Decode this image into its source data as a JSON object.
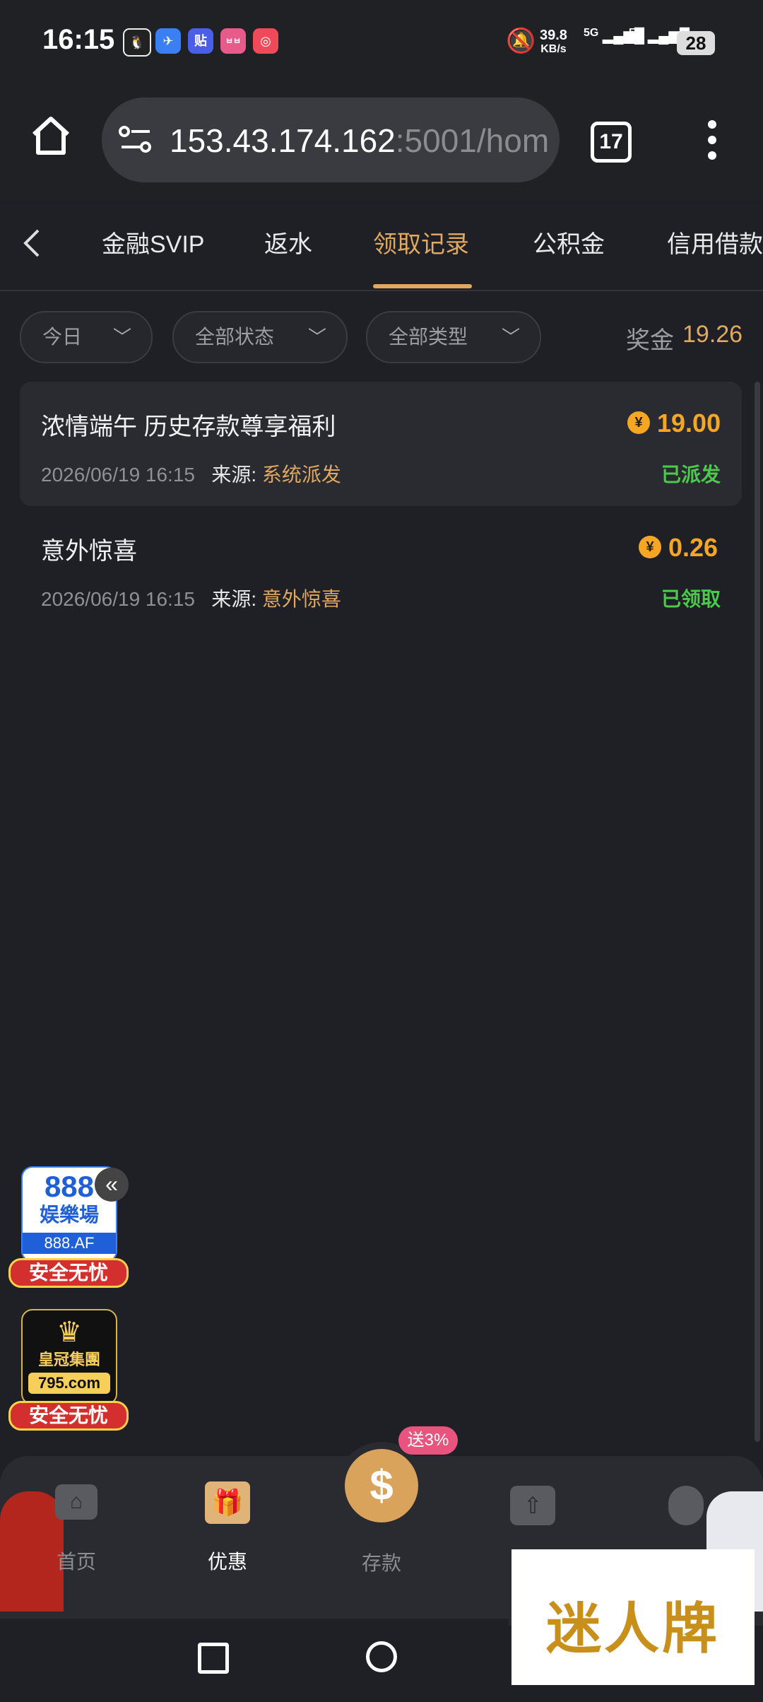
{
  "status_bar": {
    "time": "16:15",
    "net_speed_value": "39.8",
    "net_speed_unit": "KB/s",
    "signal1": "5G",
    "signal2": "5G",
    "battery": "28",
    "notification_icons": [
      "qq-icon",
      "blue-app-icon",
      "tieba-icon",
      "game-icon",
      "pink-app-icon"
    ]
  },
  "browser": {
    "url_host": "153.43.174.162",
    "url_path": ":5001/hom",
    "tabs_count": "17"
  },
  "tabs": {
    "items": [
      "金融SVIP",
      "返水",
      "领取记录",
      "公积金",
      "信用借款"
    ],
    "active": "领取记录"
  },
  "filters": {
    "date": "今日",
    "status": "全部状态",
    "type": "全部类型",
    "bonus_label": "奖金",
    "bonus_value": "19.26"
  },
  "records": [
    {
      "title": "浓情端午 历史存款尊享福利",
      "datetime": "2026/06/19 16:15",
      "source_label": "来源:",
      "source": "系统派发",
      "amount": "19.00",
      "status": "已派发"
    },
    {
      "title": "意外惊喜",
      "datetime": "2026/06/19 16:15",
      "source_label": "来源:",
      "source": "意外惊喜",
      "amount": "0.26",
      "status": "已领取"
    }
  ],
  "ads": {
    "ad1_line1": "888",
    "ad1_line2": "娱樂場",
    "ad1_line3": "888.AF",
    "ad1_badge": "安全无忧",
    "ad2_line1": "皇冠集團",
    "ad2_line2": "795.com",
    "ad2_badge": "安全无忧",
    "banner": "迷人牌"
  },
  "bottom_nav": {
    "home": "首页",
    "promo": "优惠",
    "deposit": "存款",
    "deposit_badge": "送3%"
  },
  "colors": {
    "accent": "#e0a860",
    "amount": "#f5a623",
    "success": "#4cc94c"
  }
}
